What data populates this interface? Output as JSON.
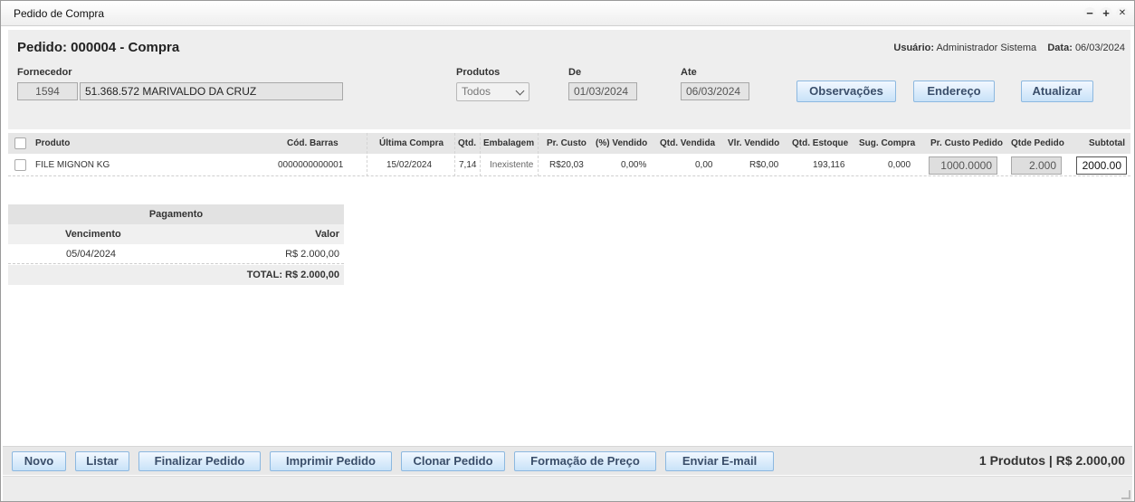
{
  "window": {
    "title": "Pedido de Compra",
    "controls": {
      "minimize": "−",
      "maximize": "+",
      "close": "✕"
    }
  },
  "header": {
    "pedido_title": "Pedido: 000004 - Compra",
    "usuario_label": "Usuário:",
    "usuario_value": "Administrador Sistema",
    "data_label": "Data:",
    "data_value": "06/03/2024"
  },
  "filters": {
    "fornecedor_label": "Fornecedor",
    "fornecedor_code": "1594",
    "fornecedor_name": "51.368.572 MARIVALDO DA CRUZ",
    "produtos_label": "Produtos",
    "produtos_selected": "Todos",
    "de_label": "De",
    "de_value": "01/03/2024",
    "ate_label": "Ate",
    "ate_value": "06/03/2024"
  },
  "actions": {
    "observacoes": "Observações",
    "endereco": "Endereço",
    "atualizar": "Atualizar"
  },
  "grid": {
    "columns": {
      "produto": "Produto",
      "cod_barras": "Cód. Barras",
      "ultima_compra": "Última Compra",
      "qtd": "Qtd.",
      "embalagem": "Embalagem",
      "pr_custo": "Pr. Custo",
      "pct_vendido": "(%) Vendido",
      "qtd_vendida": "Qtd. Vendida",
      "vlr_vendido": "Vlr. Vendido",
      "qtd_estoque": "Qtd. Estoque",
      "sug_compra": "Sug. Compra",
      "pr_custo_pedido": "Pr. Custo Pedido",
      "qtde_pedido": "Qtde Pedido",
      "subtotal": "Subtotal"
    },
    "rows": [
      {
        "produto": "FILE MIGNON KG",
        "cod_barras": "0000000000001",
        "ultima_compra": "15/02/2024",
        "qtd": "7,14",
        "embalagem": "Inexistente",
        "pr_custo": "R$20,03",
        "pct_vendido": "0,00%",
        "qtd_vendida": "0,00",
        "vlr_vendido": "R$0,00",
        "qtd_estoque": "193,116",
        "sug_compra": "0,000",
        "pr_custo_pedido": "1000.0000",
        "qtde_pedido": "2.000",
        "subtotal": "2000.00"
      }
    ]
  },
  "pagamento": {
    "title": "Pagamento",
    "vencimento_label": "Vencimento",
    "valor_label": "Valor",
    "rows": [
      {
        "vencimento": "05/04/2024",
        "valor": "R$ 2.000,00"
      }
    ],
    "total": "TOTAL: R$ 2.000,00"
  },
  "footer": {
    "novo": "Novo",
    "listar": "Listar",
    "finalizar": "Finalizar Pedido",
    "imprimir": "Imprimir Pedido",
    "clonar": "Clonar Pedido",
    "formacao": "Formação de Preço",
    "email": "Enviar E-mail",
    "summary": "1 Produtos | R$ 2.000,00"
  }
}
